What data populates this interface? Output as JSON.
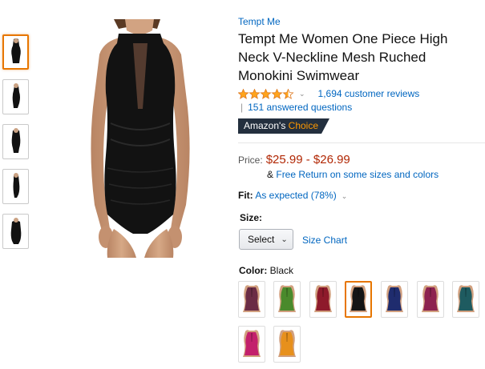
{
  "product": {
    "brand": "Tempt Me",
    "title": "Tempt Me Women One Piece High Neck V-Neckline Mesh Ruched Monokini Swimwear",
    "rating": 4.5,
    "reviews_text": "1,694 customer reviews",
    "qa_sep": "|",
    "qa_text": "151 answered questions",
    "badge_prefix": "Amazon's",
    "badge_accent": "Choice"
  },
  "price": {
    "label": "Price:",
    "value": "$25.99 - $26.99",
    "return_prefix": "&",
    "return_link": "Free Return on some sizes and colors"
  },
  "fit": {
    "label": "Fit:",
    "value": "As expected (78%)"
  },
  "size": {
    "label": "Size:",
    "select_label": "Select",
    "chart_link": "Size Chart"
  },
  "color": {
    "label": "Color:",
    "selected": "Black",
    "swatches": [
      {
        "name": "plum",
        "color": "#6b2c45"
      },
      {
        "name": "green",
        "color": "#4a8a2c"
      },
      {
        "name": "wine-red",
        "color": "#8e1a2b"
      },
      {
        "name": "black",
        "color": "#151515"
      },
      {
        "name": "navy-blue",
        "color": "#1f2c6e"
      },
      {
        "name": "berry",
        "color": "#8d2350"
      },
      {
        "name": "teal",
        "color": "#1e5b60"
      },
      {
        "name": "rose",
        "color": "#c3206c"
      },
      {
        "name": "orange",
        "color": "#e7901c"
      }
    ]
  },
  "colors": {
    "link": "#0066c0",
    "price": "#b12704",
    "badge_bg": "#232f3e",
    "badge_accent": "#ff9900",
    "selected_border": "#e77600",
    "star": "#ffa41c"
  }
}
